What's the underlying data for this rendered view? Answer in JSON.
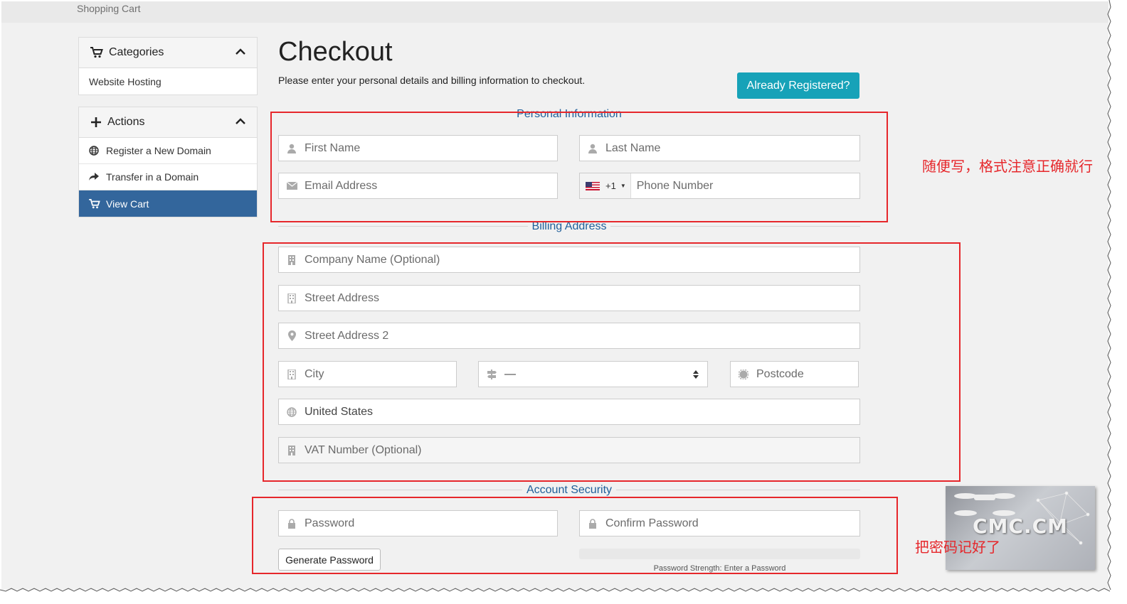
{
  "breadcrumb": "Shopping Cart",
  "sidebar": {
    "categories": {
      "title": "Categories",
      "items": [
        {
          "label": "Website Hosting"
        }
      ]
    },
    "actions": {
      "title": "Actions",
      "items": [
        {
          "label": "Register a New Domain",
          "icon": "globe-icon"
        },
        {
          "label": "Transfer in a Domain",
          "icon": "share-arrow-icon"
        },
        {
          "label": "View Cart",
          "icon": "cart-icon",
          "active": true
        }
      ]
    }
  },
  "main": {
    "title": "Checkout",
    "subtitle": "Please enter your personal details and billing information to checkout.",
    "already_registered": "Already Registered?"
  },
  "personal": {
    "title": "Personal Information",
    "first_name": "First Name",
    "last_name": "Last Name",
    "email": "Email Address",
    "phone_code": "+1",
    "phone": "Phone Number"
  },
  "billing": {
    "title": "Billing Address",
    "company": "Company Name (Optional)",
    "street": "Street Address",
    "street2": "Street Address 2",
    "city": "City",
    "state": "—",
    "postcode": "Postcode",
    "country": "United States",
    "vat": "VAT Number (Optional)"
  },
  "security": {
    "title": "Account Security",
    "password": "Password",
    "confirm": "Confirm Password",
    "generate": "Generate Password",
    "strength": "Password Strength: Enter a Password"
  },
  "annotations": {
    "note1": "随便写，格式注意正确就行",
    "note2": "把密码记好了"
  },
  "watermark": "CMC.CM",
  "colors": {
    "accent": "#17a2b8",
    "active_nav": "#33669c",
    "section_title": "#1f5f9a",
    "annotation": "#e6272b"
  }
}
